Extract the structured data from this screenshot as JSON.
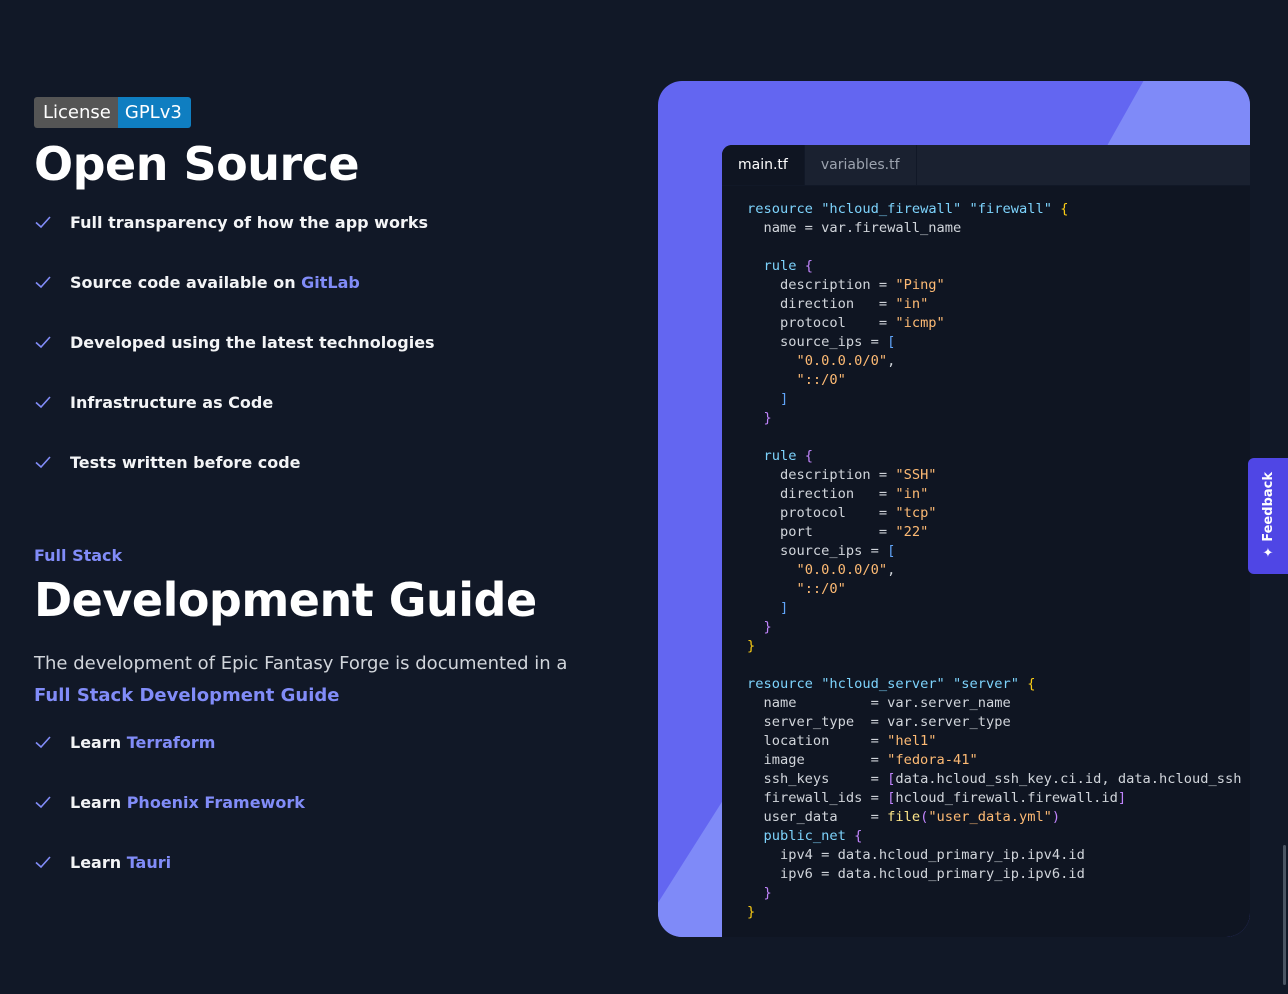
{
  "open_source": {
    "badge": {
      "label": "License",
      "value": "GPLv3"
    },
    "title": "Open Source",
    "features": [
      {
        "text": "Full transparency of how the app works",
        "link": ""
      },
      {
        "text": "Source code available on ",
        "link": "GitLab"
      },
      {
        "text": "Developed using the latest technologies",
        "link": ""
      },
      {
        "text": "Infrastructure as Code",
        "link": ""
      },
      {
        "text": "Tests written before code",
        "link": ""
      }
    ]
  },
  "dev_guide": {
    "eyebrow": "Full Stack",
    "title": "Development Guide",
    "description": "The development of Epic Fantasy Forge is documented in a",
    "description_link": "Full Stack Development Guide",
    "items": [
      {
        "text": "Learn ",
        "link": "Terraform"
      },
      {
        "text": "Learn ",
        "link": "Phoenix Framework"
      },
      {
        "text": "Learn ",
        "link": "Tauri"
      }
    ]
  },
  "editor": {
    "tabs": [
      "main.tf",
      "variables.tf"
    ],
    "active_tab": "main.tf"
  },
  "feedback": {
    "label": "Feedback",
    "icon": "sparkle-icon"
  },
  "colors": {
    "background": "#111827",
    "accent": "#6366f1",
    "link": "#818cf8",
    "badge_blue": "#0f7ec1"
  }
}
